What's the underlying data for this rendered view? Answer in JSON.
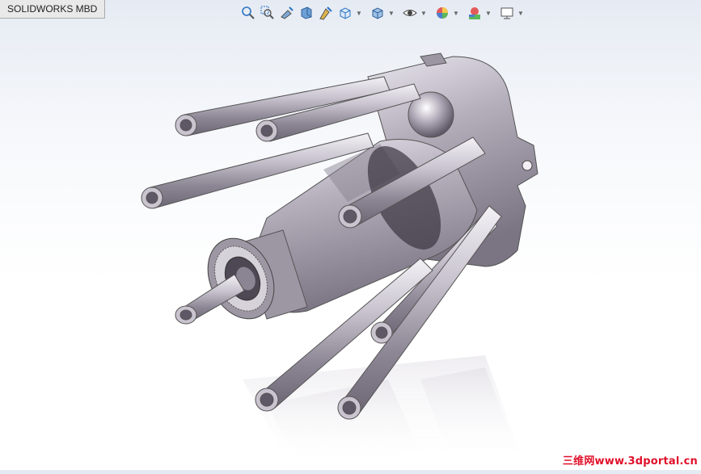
{
  "tab": {
    "label": "SOLIDWORKS MBD"
  },
  "toolbar": {
    "buttons": [
      {
        "name": "zoom-to-fit",
        "icon": "zoom-fit-icon"
      },
      {
        "name": "zoom-to-area",
        "icon": "zoom-area-icon"
      },
      {
        "name": "previous-view",
        "icon": "previous-view-icon"
      },
      {
        "name": "section-view",
        "icon": "section-view-icon"
      },
      {
        "name": "dynamic-annotation-views",
        "icon": "annotation-views-icon"
      },
      {
        "name": "view-orientation",
        "icon": "view-orientation-icon",
        "dropdown": true
      },
      {
        "name": "display-style",
        "icon": "display-style-icon",
        "dropdown": true
      },
      {
        "name": "hide-show-items",
        "icon": "eye-icon",
        "dropdown": true
      },
      {
        "name": "edit-appearance",
        "icon": "appearance-icon",
        "dropdown": true
      },
      {
        "name": "apply-scene",
        "icon": "scene-icon",
        "dropdown": true
      },
      {
        "name": "view-settings",
        "icon": "monitor-icon",
        "dropdown": true
      }
    ]
  },
  "watermark": {
    "text": "三维网www.3dportal.cn"
  },
  "colors": {
    "accent": "#e0102a",
    "metal": "#b9b4c0",
    "toolbar_blue": "#2b74c4"
  }
}
